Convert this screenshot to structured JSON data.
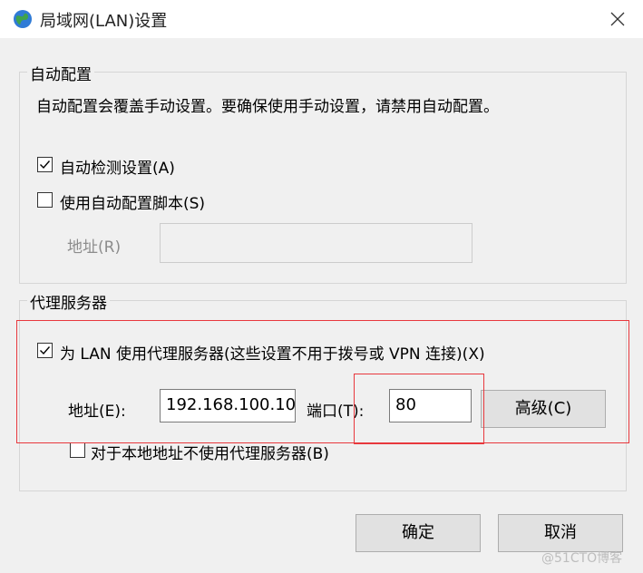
{
  "window": {
    "title": "局域网(LAN)设置",
    "icon": "globe-network-icon",
    "close_icon": "close-icon"
  },
  "auto_config": {
    "legend": "自动配置",
    "description": "自动配置会覆盖手动设置。要确保使用手动设置，请禁用自动配置。",
    "auto_detect": {
      "label": "自动检测设置(A)",
      "checked": true
    },
    "use_script": {
      "label": "使用自动配置脚本(S)",
      "checked": false
    },
    "address_label": "地址(R)",
    "address_value": ""
  },
  "proxy": {
    "legend": "代理服务器",
    "use_proxy": {
      "label": "为 LAN 使用代理服务器(这些设置不用于拨号或 VPN 连接)(X)",
      "checked": true
    },
    "address_label": "地址(E):",
    "address_value": "192.168.100.10",
    "port_label": "端口(T):",
    "port_value": "80",
    "advanced_label": "高级(C)",
    "bypass_local": {
      "label": "对于本地地址不使用代理服务器(B)",
      "checked": false
    }
  },
  "footer": {
    "ok_label": "确定",
    "cancel_label": "取消"
  },
  "watermark": "@51CTO博客",
  "colors": {
    "highlight": "#e8383d",
    "window_bg": "#f0f0f0",
    "titlebar_bg": "#ffffff"
  }
}
